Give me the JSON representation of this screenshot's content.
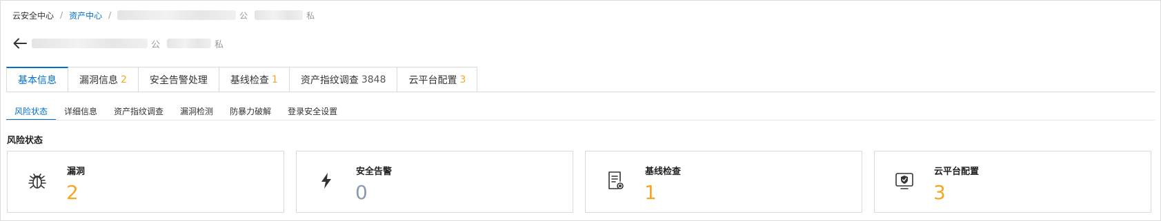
{
  "breadcrumb": {
    "root": "云安全中心",
    "parent": "资产中心",
    "separator": "/",
    "public_suffix": "公",
    "private_suffix": "私"
  },
  "title": {
    "public_suffix": "公",
    "private_suffix": "私",
    "back_icon": "arrow-left-icon"
  },
  "tabs": [
    {
      "label": "基本信息",
      "count": ""
    },
    {
      "label": "漏洞信息",
      "count": "2"
    },
    {
      "label": "安全告警处理",
      "count": ""
    },
    {
      "label": "基线检查",
      "count": "1"
    },
    {
      "label": "资产指纹调查",
      "count": "3848"
    },
    {
      "label": "云平台配置",
      "count": "3"
    }
  ],
  "subtabs": [
    "风险状态",
    "详细信息",
    "资产指纹调查",
    "漏洞检测",
    "防暴力破解",
    "登录安全设置"
  ],
  "section_title": "风险状态",
  "cards": [
    {
      "label": "漏洞",
      "value": "2",
      "icon": "bug-icon",
      "color": "#f5a623"
    },
    {
      "label": "安全告警",
      "value": "0",
      "icon": "lightning-icon",
      "color": "#8a9bb0"
    },
    {
      "label": "基线检查",
      "value": "1",
      "icon": "checklist-icon",
      "color": "#f5a623"
    },
    {
      "label": "云平台配置",
      "value": "3",
      "icon": "shield-monitor-icon",
      "color": "#f5a623"
    }
  ],
  "colors": {
    "accent": "#0070cc",
    "warning": "#f5a623",
    "zero": "#8a9bb0"
  }
}
